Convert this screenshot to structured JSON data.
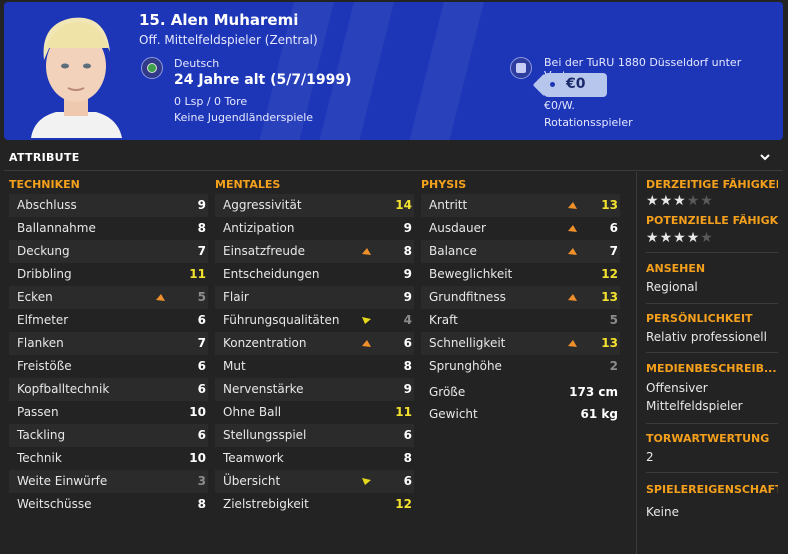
{
  "header": {
    "name": "15. Alen Muharemi",
    "position": "Off. Mittelfeldspieler (Zentral)",
    "nationality": "Deutsch",
    "age": "24 Jahre alt (5/7/1999)",
    "apps": "0 Lsp / 0 Tore",
    "youth": "Keine Jugendländerspiele",
    "contract": "Bei der TuRU 1880 Düsseldorf unter Vertrag",
    "value": "€0",
    "wage": "€0/W.",
    "squad_status": "Rotationsspieler",
    "colors": {
      "banner": "#1d36b8",
      "accent": "#f4a01c",
      "highlight": "#f2e12e"
    }
  },
  "section_title": "ATTRIBUTE",
  "technical": {
    "title": "TECHNIKEN",
    "rows": [
      {
        "label": "Abschluss",
        "value": "9",
        "color": "#ffffff",
        "arrow": ""
      },
      {
        "label": "Ballannahme",
        "value": "8",
        "color": "#ffffff",
        "arrow": ""
      },
      {
        "label": "Deckung",
        "value": "7",
        "color": "#ffffff",
        "arrow": ""
      },
      {
        "label": "Dribbling",
        "value": "11",
        "color": "#f2e12e",
        "arrow": ""
      },
      {
        "label": "Ecken",
        "value": "5",
        "color": "#8c8c8c",
        "arrow": "orange"
      },
      {
        "label": "Elfmeter",
        "value": "6",
        "color": "#ffffff",
        "arrow": ""
      },
      {
        "label": "Flanken",
        "value": "7",
        "color": "#ffffff",
        "arrow": ""
      },
      {
        "label": "Freistöße",
        "value": "6",
        "color": "#ffffff",
        "arrow": ""
      },
      {
        "label": "Kopfballtechnik",
        "value": "6",
        "color": "#ffffff",
        "arrow": ""
      },
      {
        "label": "Passen",
        "value": "10",
        "color": "#ffffff",
        "arrow": ""
      },
      {
        "label": "Tackling",
        "value": "6",
        "color": "#ffffff",
        "arrow": ""
      },
      {
        "label": "Technik",
        "value": "10",
        "color": "#ffffff",
        "arrow": ""
      },
      {
        "label": "Weite Einwürfe",
        "value": "3",
        "color": "#8c8c8c",
        "arrow": ""
      },
      {
        "label": "Weitschüsse",
        "value": "8",
        "color": "#ffffff",
        "arrow": ""
      }
    ]
  },
  "mental": {
    "title": "MENTALES",
    "rows": [
      {
        "label": "Aggressivität",
        "value": "14",
        "color": "#f2e12e",
        "arrow": ""
      },
      {
        "label": "Antizipation",
        "value": "9",
        "color": "#ffffff",
        "arrow": ""
      },
      {
        "label": "Einsatzfreude",
        "value": "8",
        "color": "#ffffff",
        "arrow": "orange"
      },
      {
        "label": "Entscheidungen",
        "value": "9",
        "color": "#ffffff",
        "arrow": ""
      },
      {
        "label": "Flair",
        "value": "9",
        "color": "#ffffff",
        "arrow": ""
      },
      {
        "label": "Führungsqualitäten",
        "value": "4",
        "color": "#8c8c8c",
        "arrow": "yellow"
      },
      {
        "label": "Konzentration",
        "value": "6",
        "color": "#ffffff",
        "arrow": "orange"
      },
      {
        "label": "Mut",
        "value": "8",
        "color": "#ffffff",
        "arrow": ""
      },
      {
        "label": "Nervenstärke",
        "value": "9",
        "color": "#ffffff",
        "arrow": ""
      },
      {
        "label": "Ohne Ball",
        "value": "11",
        "color": "#f2e12e",
        "arrow": ""
      },
      {
        "label": "Stellungsspiel",
        "value": "6",
        "color": "#ffffff",
        "arrow": ""
      },
      {
        "label": "Teamwork",
        "value": "8",
        "color": "#ffffff",
        "arrow": ""
      },
      {
        "label": "Übersicht",
        "value": "6",
        "color": "#ffffff",
        "arrow": "yellow"
      },
      {
        "label": "Zielstrebigkeit",
        "value": "12",
        "color": "#f2e12e",
        "arrow": ""
      }
    ]
  },
  "physical": {
    "title": "PHYSIS",
    "rows": [
      {
        "label": "Antritt",
        "value": "13",
        "color": "#f2e12e",
        "arrow": "orange"
      },
      {
        "label": "Ausdauer",
        "value": "6",
        "color": "#ffffff",
        "arrow": "orange"
      },
      {
        "label": "Balance",
        "value": "7",
        "color": "#ffffff",
        "arrow": "orange"
      },
      {
        "label": "Beweglichkeit",
        "value": "12",
        "color": "#f2e12e",
        "arrow": ""
      },
      {
        "label": "Grundfitness",
        "value": "13",
        "color": "#f2e12e",
        "arrow": "orange"
      },
      {
        "label": "Kraft",
        "value": "5",
        "color": "#8c8c8c",
        "arrow": ""
      },
      {
        "label": "Schnelligkeit",
        "value": "13",
        "color": "#f2e12e",
        "arrow": "orange"
      },
      {
        "label": "Sprunghöhe",
        "value": "2",
        "color": "#8c8c8c",
        "arrow": ""
      }
    ],
    "height_label": "Größe",
    "height": "173 cm",
    "weight_label": "Gewicht",
    "weight": "61 kg"
  },
  "side": {
    "current_ability_title": "DERZEITIGE FÄHIGKEIT",
    "current_ability_stars": 3,
    "potential_title": "POTENZIELLE FÄHIGK...",
    "potential_stars": 4,
    "reputation_title": "ANSEHEN",
    "reputation": "Regional",
    "personality_title": "PERSÖNLICHKEIT",
    "personality": "Relativ professionell",
    "media_title": "MEDIENBESCHREIB...",
    "media_line1": "Offensiver",
    "media_line2": "Mittelfeldspieler",
    "gk_title": "TORWARTWERTUNG",
    "gk": "2",
    "traits_title": "SPIELEREIGENSCHAFT",
    "traits": "Keine"
  }
}
